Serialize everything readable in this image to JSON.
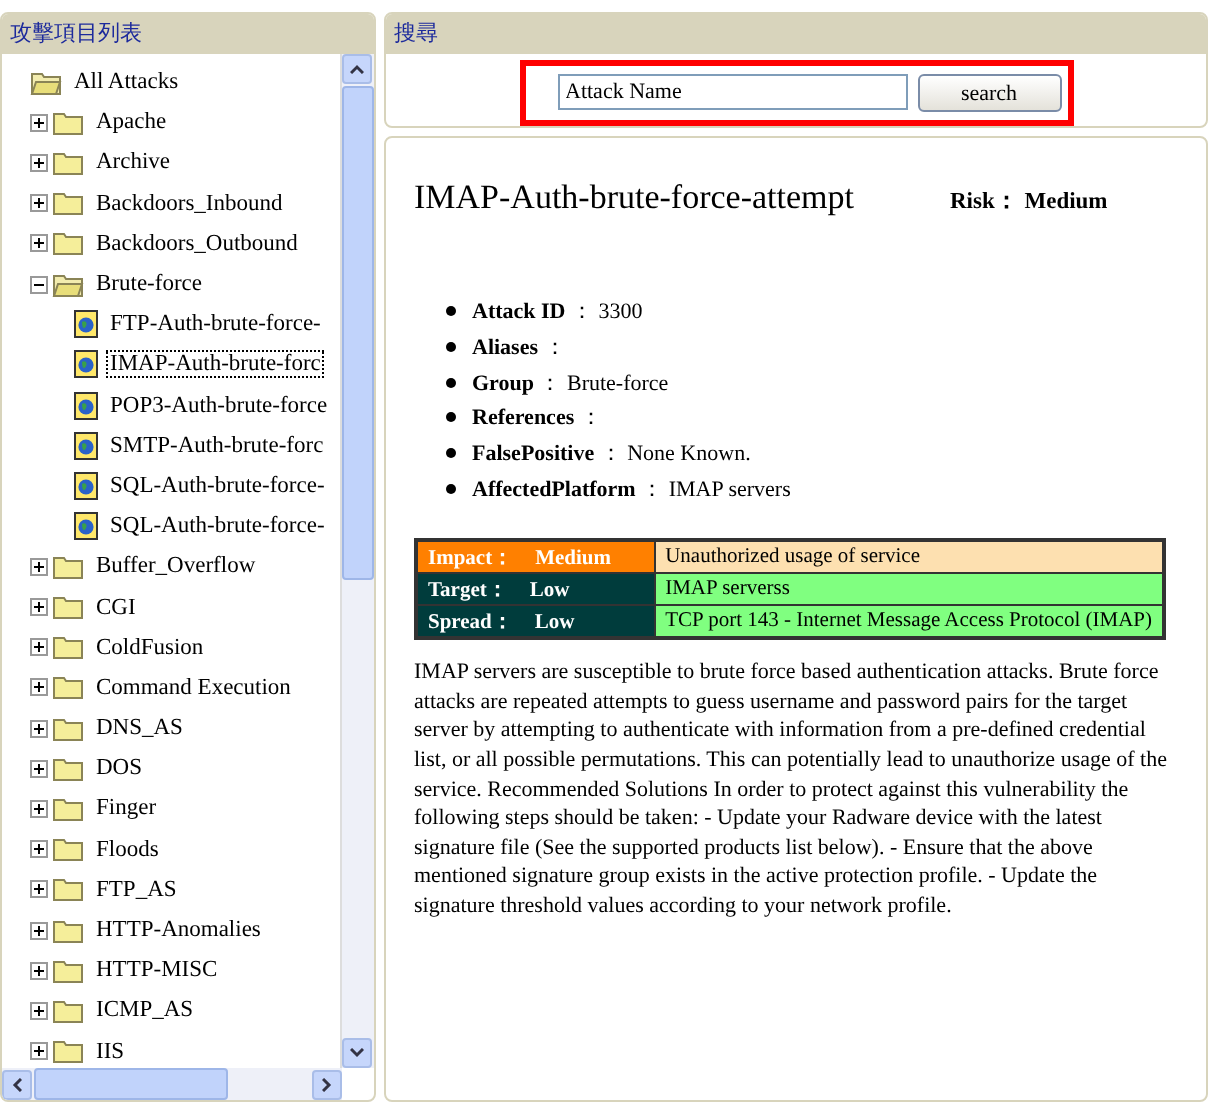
{
  "tree_panel": {
    "title": "攻擊項目列表",
    "tree": {
      "label": "All Attacks",
      "expanded": true,
      "children": [
        {
          "label": "Apache",
          "expanded": false,
          "kind": "folder"
        },
        {
          "label": "Archive",
          "expanded": false,
          "kind": "folder"
        },
        {
          "label": "Backdoors_Inbound",
          "expanded": false,
          "kind": "folder"
        },
        {
          "label": "Backdoors_Outbound",
          "expanded": false,
          "kind": "folder"
        },
        {
          "label": "Brute-force",
          "expanded": true,
          "kind": "folder",
          "children": [
            {
              "label": "FTP-Auth-brute-force-",
              "kind": "attack",
              "selected": false
            },
            {
              "label": "IMAP-Auth-brute-forc",
              "kind": "attack",
              "selected": true
            },
            {
              "label": "POP3-Auth-brute-force",
              "kind": "attack",
              "selected": false
            },
            {
              "label": "SMTP-Auth-brute-forc",
              "kind": "attack",
              "selected": false
            },
            {
              "label": "SQL-Auth-brute-force-",
              "kind": "attack",
              "selected": false
            },
            {
              "label": "SQL-Auth-brute-force-",
              "kind": "attack",
              "selected": false
            }
          ]
        },
        {
          "label": "Buffer_Overflow",
          "expanded": false,
          "kind": "folder"
        },
        {
          "label": "CGI",
          "expanded": false,
          "kind": "folder"
        },
        {
          "label": "ColdFusion",
          "expanded": false,
          "kind": "folder"
        },
        {
          "label": "Command Execution",
          "expanded": false,
          "kind": "folder"
        },
        {
          "label": "DNS_AS",
          "expanded": false,
          "kind": "folder"
        },
        {
          "label": "DOS",
          "expanded": false,
          "kind": "folder"
        },
        {
          "label": "Finger",
          "expanded": false,
          "kind": "folder"
        },
        {
          "label": "Floods",
          "expanded": false,
          "kind": "folder"
        },
        {
          "label": "FTP_AS",
          "expanded": false,
          "kind": "folder"
        },
        {
          "label": "HTTP-Anomalies",
          "expanded": false,
          "kind": "folder"
        },
        {
          "label": "HTTP-MISC",
          "expanded": false,
          "kind": "folder"
        },
        {
          "label": "ICMP_AS",
          "expanded": false,
          "kind": "folder"
        },
        {
          "label": "IIS",
          "expanded": false,
          "kind": "folder"
        }
      ]
    }
  },
  "search_panel": {
    "title": "搜尋",
    "highlighted": true,
    "field": {
      "value": "Attack Name"
    },
    "button": "search"
  },
  "detail": {
    "title": "IMAP-Auth-brute-force-attempt",
    "risk_label": "Risk：",
    "risk_value": "Medium",
    "properties": [
      {
        "name": "**Attack ID** ：",
        "value": "3300"
      },
      {
        "name": "**Aliases** ："
      },
      {
        "name": "**Group** ：",
        "value": "Brute-force"
      },
      {
        "name": "**References** ："
      },
      {
        "name": "**FalsePositive** ：",
        "value": "None Known."
      },
      {
        "name": "**AffectedPlatform** ：",
        "value": "IMAP servers"
      }
    ],
    "ratings": [
      {
        "label": "Impact：",
        "level": "Medium",
        "color": "#ff8000",
        "detail": {
          "text": "Unauthorized usage of service",
          "color": "#fde0b0"
        }
      },
      {
        "label": "Target：",
        "level": "Low",
        "color": "#003c3c",
        "detail": {
          "text": "IMAP serverss",
          "color": "#80ff80"
        }
      },
      {
        "label": "Spread：",
        "level": "Low",
        "color": "#003c3c",
        "detail": {
          "text": "TCP port 143 - Internet Message Access Protocol (IMAP)",
          "color": "#80ff80"
        }
      }
    ],
    "description": "IMAP servers are susceptible to brute force based authentication attacks. Brute force attacks are repeated attempts to guess username and password pairs for the target server by attempting to authenticate with information from a pre-defined credential list, or all possible permutations. This can potentially lead to unauthorize usage of the service. Recommended Solutions In order to protect against this vulnerability the following steps should be taken: - Update your Radware device with the latest signature file (See the supported products list below). - Ensure that the above mentioned signature group exists in the active protection profile. - Update the signature threshold values according to your network profile."
  }
}
